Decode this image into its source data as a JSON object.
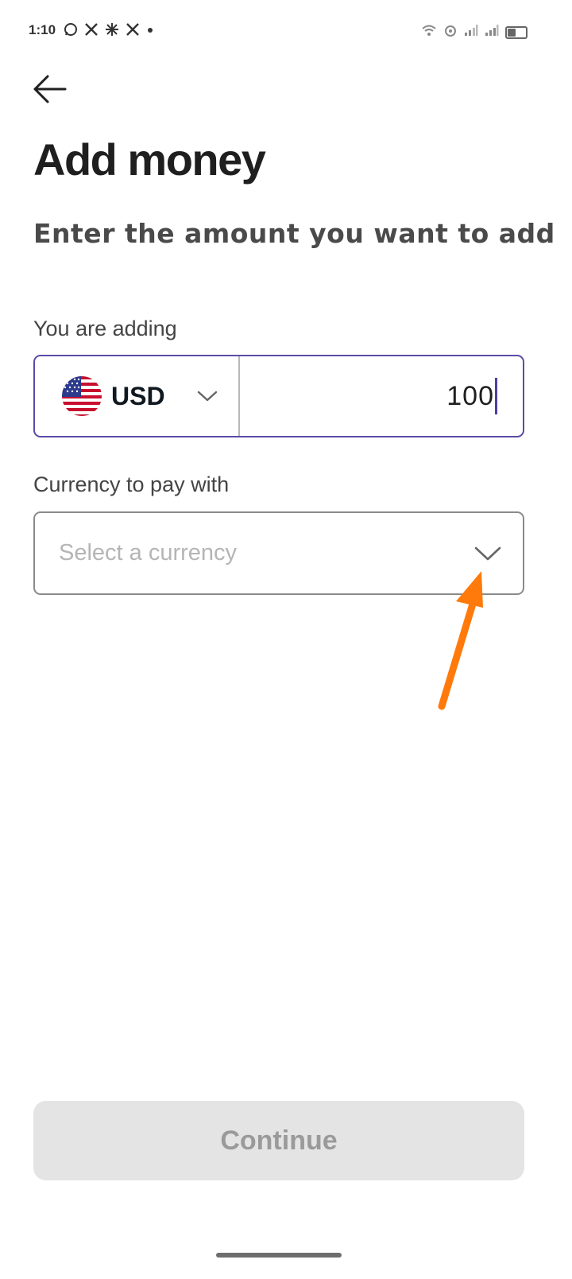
{
  "status_bar": {
    "time": "1:10",
    "left_icons": [
      "whatsapp-icon",
      "x-icon",
      "asterisk-icon",
      "x-icon",
      "dot-icon"
    ],
    "right_icons": [
      "wifi-icon",
      "hotspot-icon",
      "signal-icon",
      "signal-icon",
      "battery-icon"
    ]
  },
  "header": {
    "back_icon": "arrow-left-icon",
    "title": "Add money",
    "subtitle": "Enter the amount you want to add"
  },
  "adding": {
    "label": "You are adding",
    "currency_code": "USD",
    "currency_flag": "us-flag-icon",
    "amount": "100"
  },
  "pay_with": {
    "label": "Currency to pay with",
    "placeholder": "Select a currency"
  },
  "footer": {
    "continue_label": "Continue"
  },
  "colors": {
    "focus_border": "#5b4ba6",
    "annotation_arrow": "#ff7a0a",
    "disabled_button": "#e4e4e4"
  }
}
